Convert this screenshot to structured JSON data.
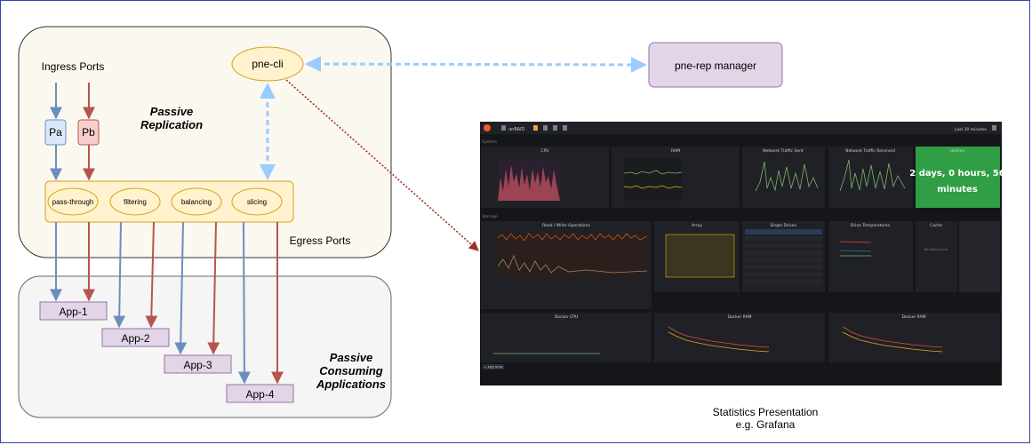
{
  "regions": {
    "replication": {
      "title_line1": "Passive",
      "title_line2": "Replication"
    },
    "consuming": {
      "title_line1": "Passive",
      "title_line2": "Consuming",
      "title_line3": "Applications"
    }
  },
  "labels": {
    "ingress_ports": "Ingress Ports",
    "egress_ports": "Egress Ports",
    "stats_line1": "Statistics Presentation",
    "stats_line2": "e.g. Grafana"
  },
  "nodes": {
    "pne_cli": "pne-cli",
    "pne_rep_manager": "pne-rep manager",
    "port_a": "Pa",
    "port_b": "Pb",
    "modes": [
      "pass-through",
      "filtering",
      "balancing",
      "slicing"
    ],
    "apps": [
      "App-1",
      "App-2",
      "App-3",
      "App-4"
    ]
  },
  "grafana": {
    "dashboard_name": "unRAID",
    "time_range": "Last 30 minutes",
    "row_system": "System",
    "row_storage": "Storage",
    "panels_row1": [
      "CPU",
      "RAM",
      "Network Traffic Sent",
      "Network Traffic Received"
    ],
    "uptime_title": "Uptime",
    "uptime_value_line1": "2 days, 0 hours, 56",
    "uptime_value_line2": "minutes",
    "panels_row2": [
      "Read / Write Operations",
      "Array",
      "Single Drives",
      "Drive Temperatures",
      "Cache"
    ],
    "no_data": "No data points",
    "panels_row3": [
      "Docker CPU",
      "Docker RAM",
      "Docker RAM"
    ],
    "add_row": "+ ADD ROW"
  },
  "colors": {
    "region_fill": "#fbf8ef",
    "consuming_fill": "#f5f5f5",
    "node_fill": "#fff2cc",
    "node_stroke": "#d6a21e",
    "app_fill": "#e1d5e7",
    "app_stroke": "#9673a6",
    "blue_arrow": "#6c8ebf",
    "red_arrow": "#b85450",
    "dash_arrow": "#99ccff",
    "dotted_arrow": "#a0302a",
    "uptime_green": "#2f9e44"
  }
}
